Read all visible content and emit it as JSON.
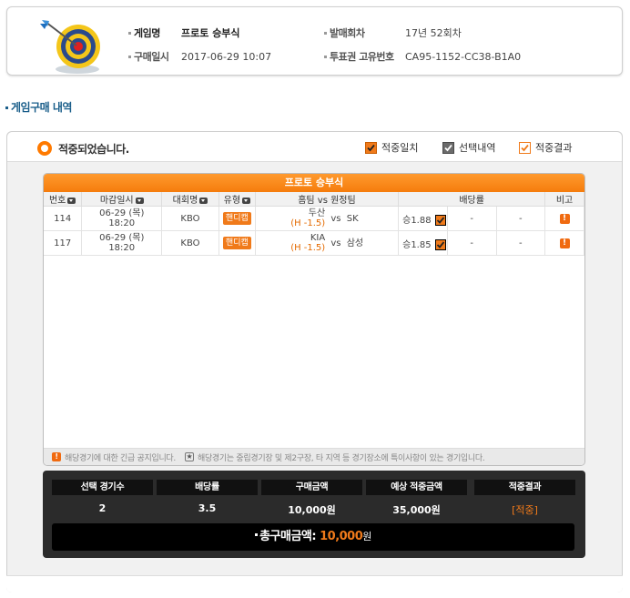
{
  "info": {
    "game_name_label": "게임명",
    "game_name": "프로토 승부식",
    "round_label": "발매회차",
    "round": "17년 52회차",
    "purchase_date_label": "구매일시",
    "purchase_date": "2017-06-29 10:07",
    "ticket_id_label": "투표권 고유번호",
    "ticket_id": "CA95-1152-CC38-B1A0"
  },
  "section_title": "게임구매 내역",
  "panel": {
    "status_text": "적중되었습니다.",
    "legend": [
      {
        "label": "적중일치",
        "style": "orange"
      },
      {
        "label": "선택내역",
        "style": "gray"
      },
      {
        "label": "적중결과",
        "style": "outline"
      }
    ]
  },
  "table": {
    "title": "프로토 승부식",
    "columns": [
      "번호",
      "마감일시",
      "대회명",
      "유형",
      "홈팀 vs 원정팀",
      "배당률",
      "비고"
    ],
    "rows": [
      {
        "no": "114",
        "deadline_date": "06-29 (목)",
        "deadline_time": "18:20",
        "league": "KBO",
        "type": "핸디캡",
        "home": "두산",
        "handicap": "(H -1.5)",
        "vs": "vs",
        "away": "SK",
        "odds": "승1.88",
        "draw": "-",
        "lose": "-",
        "note": "!"
      },
      {
        "no": "117",
        "deadline_date": "06-29 (목)",
        "deadline_time": "18:20",
        "league": "KBO",
        "type": "핸디캡",
        "home": "KIA",
        "handicap": "(H -1.5)",
        "vs": "vs",
        "away": "삼성",
        "odds": "승1.85",
        "draw": "-",
        "lose": "-",
        "note": "!"
      }
    ],
    "notice_urgent": "해당경기에 대한 긴급 공지입니다.",
    "notice_neutral": "해당경기는 중립경기장 및 제2구장, 타 지역 등 경기장소에 특이사항이 있는 경기입니다."
  },
  "summary": {
    "headers": [
      "선택 경기수",
      "배당률",
      "구매금액",
      "예상 적중금액",
      "적중결과"
    ],
    "values": [
      "2",
      "3.5",
      "10,000원",
      "35,000원",
      "[적중]"
    ],
    "total_label": "총구매금액:",
    "total_amount": "10,000",
    "total_unit": "원"
  },
  "colors": {
    "accent": "#f07a1a",
    "title_blue": "#1a5e8a"
  },
  "icons": [
    "target-icon",
    "check-icon",
    "sort-icon",
    "alert-icon",
    "star-icon"
  ]
}
